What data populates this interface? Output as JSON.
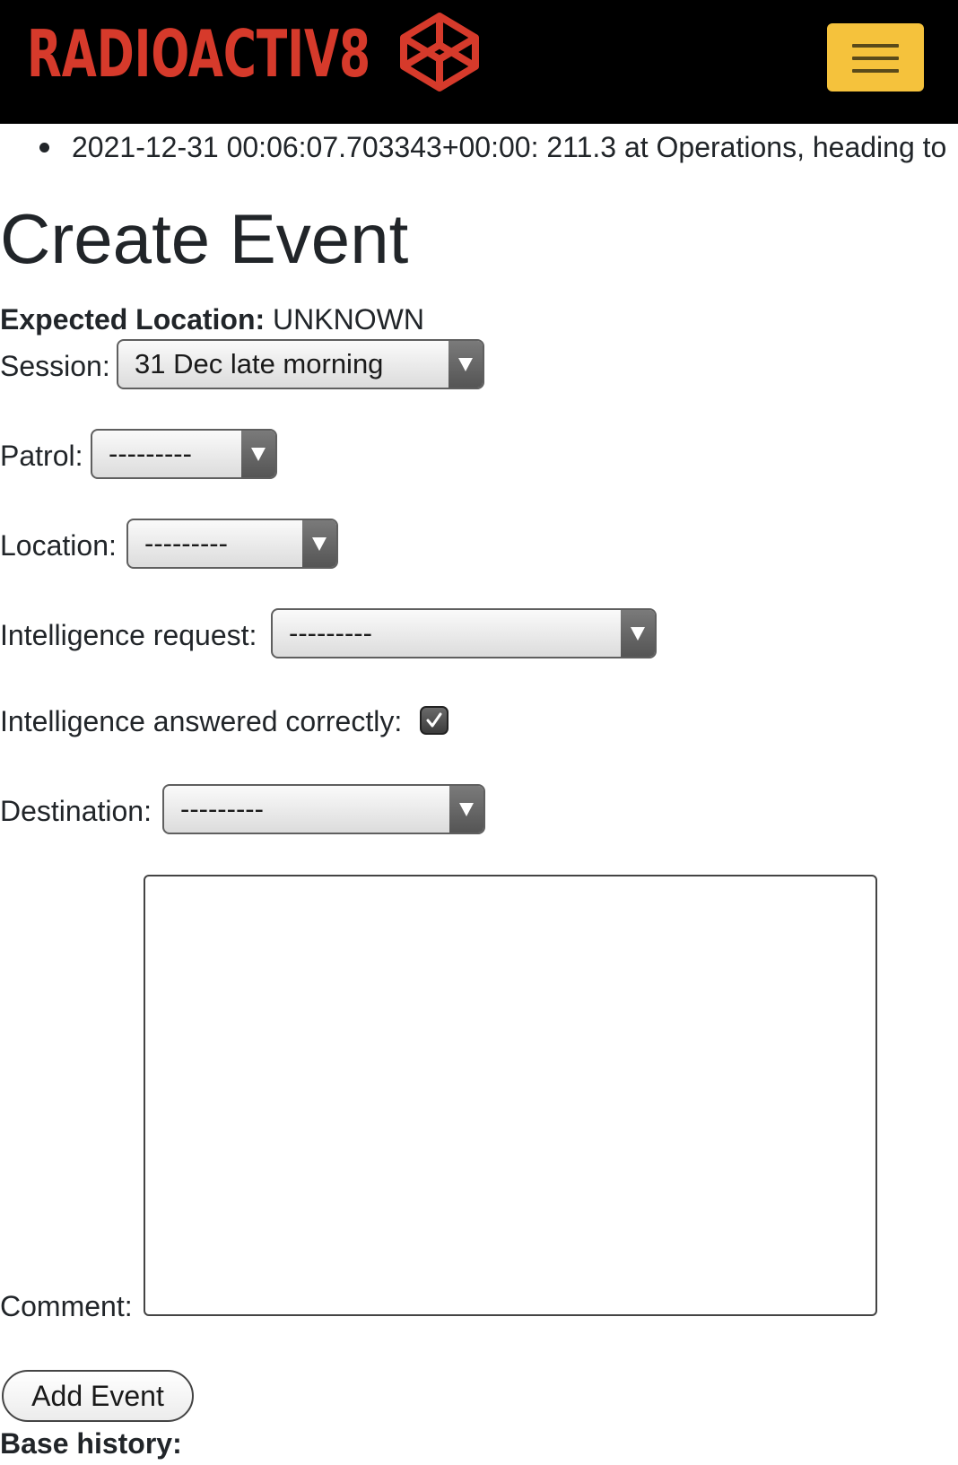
{
  "navbar": {
    "brand": "RADIOACTIV8",
    "brand_color": "#d63a2b",
    "menu_icon": "hamburger-icon",
    "toggler_color": "#f5c23c"
  },
  "history": {
    "items": [
      "2021-12-31 00:06:07.703343+00:00: 211.3 at Operations, heading to"
    ]
  },
  "page": {
    "title": "Create Event"
  },
  "expected": {
    "label": "Expected Location:",
    "value": "UNKNOWN"
  },
  "form": {
    "session": {
      "label": "Session:",
      "value": "31 Dec late morning"
    },
    "patrol": {
      "label": "Patrol:",
      "value": "---------"
    },
    "location": {
      "label": "Location:",
      "value": "---------"
    },
    "intelligence_request": {
      "label": "Intelligence request:",
      "value": "---------"
    },
    "intelligence_answered": {
      "label": "Intelligence answered correctly:",
      "checked": true
    },
    "destination": {
      "label": "Destination:",
      "value": "---------"
    },
    "comment": {
      "label": "Comment:",
      "value": ""
    },
    "submit_label": "Add Event"
  },
  "base_history": {
    "label": "Base history:"
  }
}
